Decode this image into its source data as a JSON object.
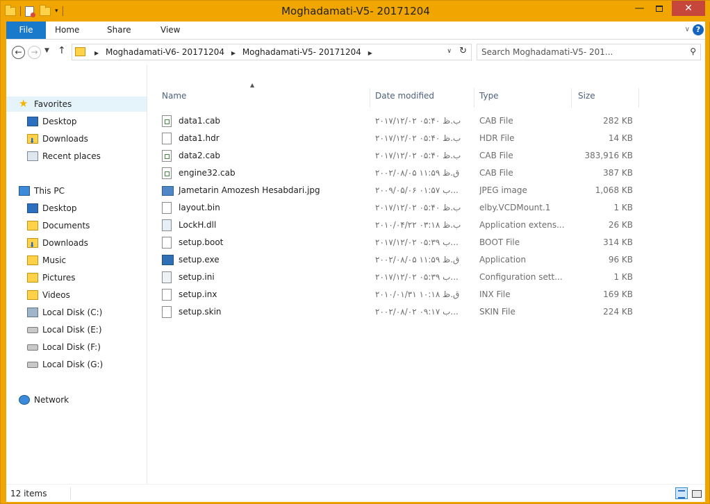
{
  "window": {
    "title": "Moghadamati-V5- 20171204"
  },
  "ribbon": {
    "tabs": [
      {
        "label": "File"
      },
      {
        "label": "Home"
      },
      {
        "label": "Share"
      },
      {
        "label": "View"
      }
    ]
  },
  "address": {
    "crumbs": [
      "Moghadamati-V6- 20171204",
      "Moghadamati-V5- 20171204"
    ]
  },
  "search": {
    "placeholder": "Search Moghadamati-V5- 201..."
  },
  "navpane": {
    "favorites": "Favorites",
    "favorite_items": [
      "Desktop",
      "Downloads",
      "Recent places"
    ],
    "thispc": "This PC",
    "pc_items": [
      "Desktop",
      "Documents",
      "Downloads",
      "Music",
      "Pictures",
      "Videos",
      "Local Disk (C:)",
      "Local Disk (E:)",
      "Local Disk (F:)",
      "Local Disk (G:)"
    ],
    "network": "Network"
  },
  "columns": {
    "name": "Name",
    "date": "Date modified",
    "type": "Type",
    "size": "Size"
  },
  "files": [
    {
      "name": "data1.cab",
      "date": "۲۰۱۷/۱۲/۰۲ ب.ظ ۰۵:۴۰",
      "type": "CAB File",
      "size": "282 KB"
    },
    {
      "name": "data1.hdr",
      "date": "۲۰۱۷/۱۲/۰۲ ب.ظ ۰۵:۴۰",
      "type": "HDR File",
      "size": "14 KB"
    },
    {
      "name": "data2.cab",
      "date": "۲۰۱۷/۱۲/۰۲ ب.ظ ۰۵:۴۰",
      "type": "CAB File",
      "size": "383,916 KB"
    },
    {
      "name": "engine32.cab",
      "date": "۲۰۰۲/۰۸/۰۵ ق.ظ ۱۱:۵۹",
      "type": "CAB File",
      "size": "387 KB"
    },
    {
      "name": "Jametarin Amozesh Hesabdari.jpg",
      "date": "۲۰۰۹/۰۵/۰۶ ب ۰۱:۵۷...",
      "type": "JPEG image",
      "size": "1,068 KB"
    },
    {
      "name": "layout.bin",
      "date": "۲۰۱۷/۱۲/۰۲ ب.ظ ۰۵:۴۰",
      "type": "elby.VCDMount.1",
      "size": "1 KB"
    },
    {
      "name": "LockH.dll",
      "date": "۲۰۱۰/۰۴/۲۲ ب.ظ ۰۳:۱۸",
      "type": "Application extens...",
      "size": "26 KB"
    },
    {
      "name": "setup.boot",
      "date": "۲۰۱۷/۱۲/۰۲ ب ۰۵:۳۹...",
      "type": "BOOT File",
      "size": "314 KB"
    },
    {
      "name": "setup.exe",
      "date": "۲۰۰۲/۰۸/۰۵ ق.ظ ۱۱:۵۹",
      "type": "Application",
      "size": "96 KB"
    },
    {
      "name": "setup.ini",
      "date": "۲۰۱۷/۱۲/۰۲ ب ۰۵:۳۹...",
      "type": "Configuration sett...",
      "size": "1 KB"
    },
    {
      "name": "setup.inx",
      "date": "۲۰۱۰/۰۱/۳۱ ق.ظ ۱۰:۱۸",
      "type": "INX File",
      "size": "169 KB"
    },
    {
      "name": "setup.skin",
      "date": "۲۰۰۲/۰۸/۰۲ ب ۰۹:۱۷...",
      "type": "SKIN File",
      "size": "224 KB"
    }
  ],
  "status": {
    "count": "12 items"
  },
  "colors": {
    "frame": "#f0a500",
    "file_tab": "#1979ca",
    "close": "#c7463b"
  }
}
